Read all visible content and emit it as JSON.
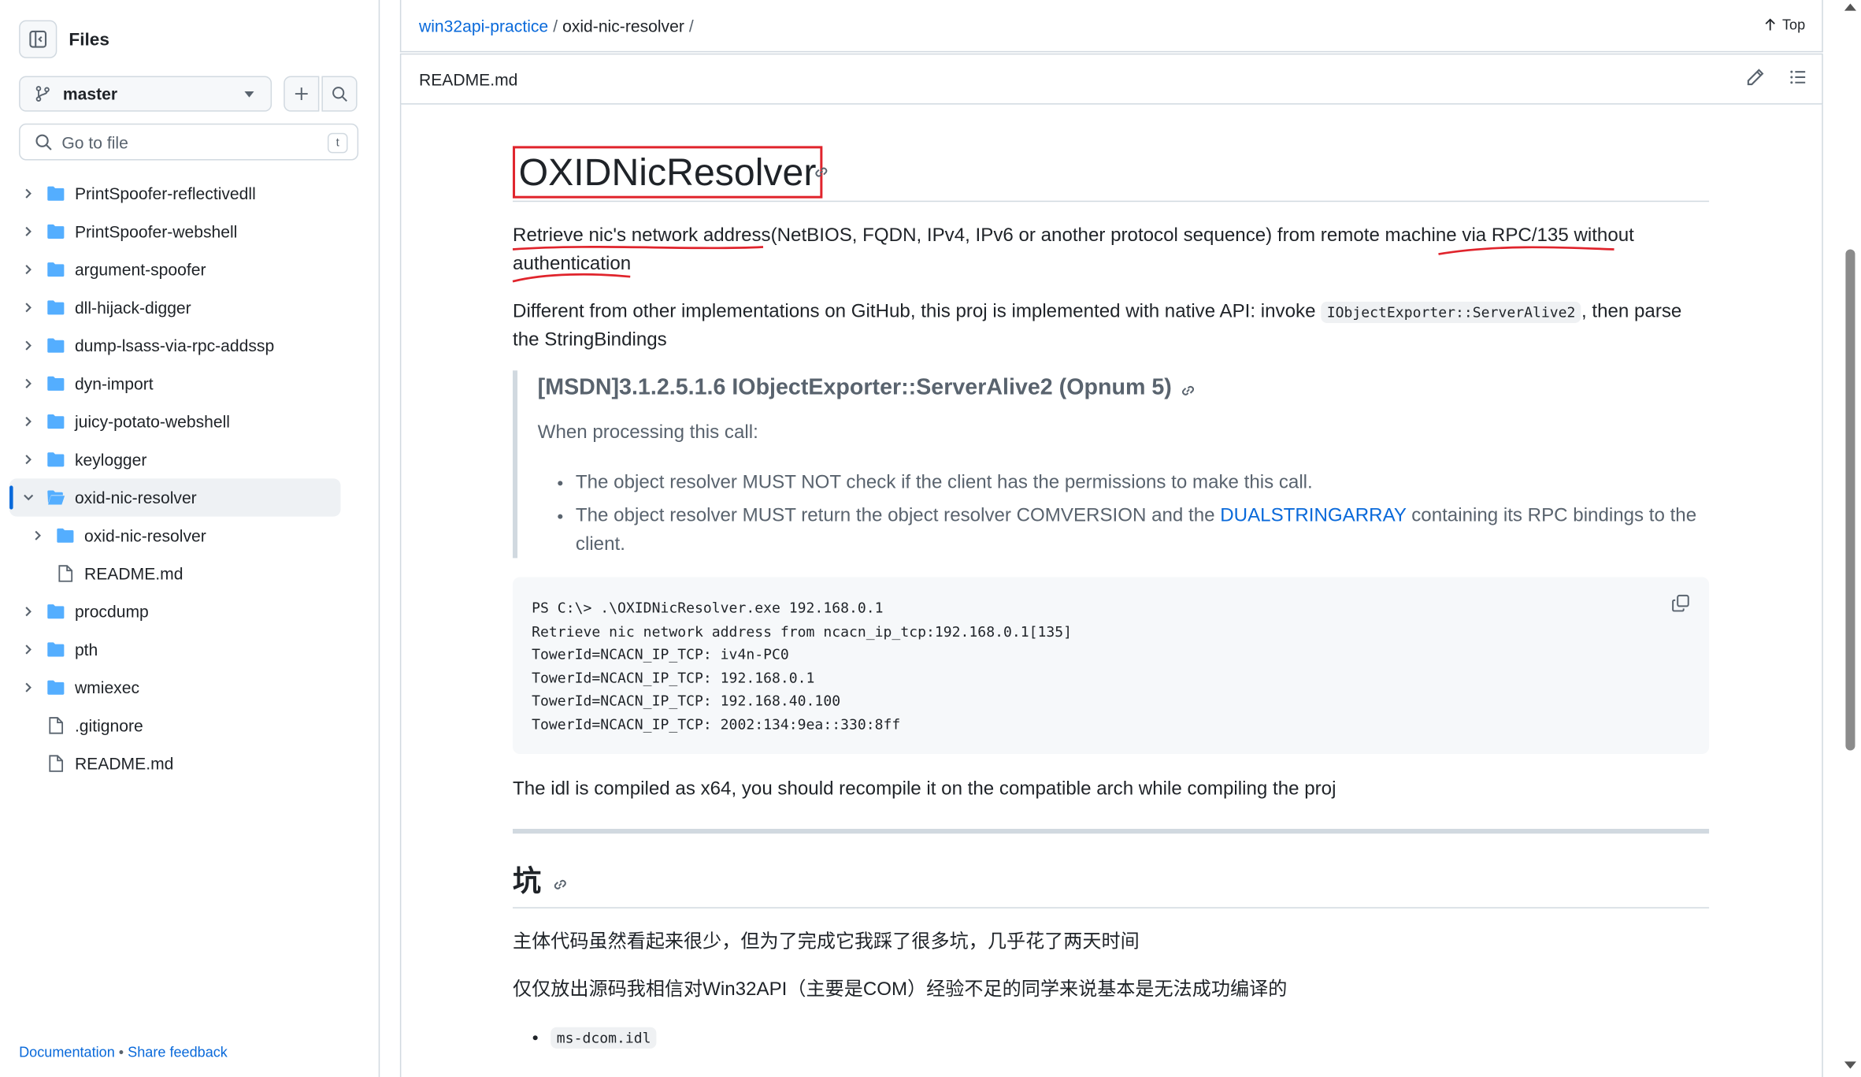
{
  "sidebar": {
    "title": "Files",
    "branch": "master",
    "goto_placeholder": "Go to file",
    "goto_shortcut": "t",
    "tree": [
      {
        "label": "PrintSpoofer-reflectivedll",
        "type": "folder",
        "level": 0,
        "expanded": false
      },
      {
        "label": "PrintSpoofer-webshell",
        "type": "folder",
        "level": 0,
        "expanded": false
      },
      {
        "label": "argument-spoofer",
        "type": "folder",
        "level": 0,
        "expanded": false
      },
      {
        "label": "dll-hijack-digger",
        "type": "folder",
        "level": 0,
        "expanded": false
      },
      {
        "label": "dump-lsass-via-rpc-addssp",
        "type": "folder",
        "level": 0,
        "expanded": false
      },
      {
        "label": "dyn-import",
        "type": "folder",
        "level": 0,
        "expanded": false
      },
      {
        "label": "juicy-potato-webshell",
        "type": "folder",
        "level": 0,
        "expanded": false
      },
      {
        "label": "keylogger",
        "type": "folder",
        "level": 0,
        "expanded": false
      },
      {
        "label": "oxid-nic-resolver",
        "type": "folder",
        "level": 0,
        "expanded": true,
        "active": true
      },
      {
        "label": "oxid-nic-resolver",
        "type": "folder",
        "level": 1,
        "expanded": false
      },
      {
        "label": "README.md",
        "type": "file",
        "level": 1
      },
      {
        "label": "procdump",
        "type": "folder",
        "level": 0,
        "expanded": false
      },
      {
        "label": "pth",
        "type": "folder",
        "level": 0,
        "expanded": false
      },
      {
        "label": "wmiexec",
        "type": "folder",
        "level": 0,
        "expanded": false
      },
      {
        "label": ".gitignore",
        "type": "file",
        "level": 0
      },
      {
        "label": "README.md",
        "type": "file",
        "level": 0
      }
    ],
    "footer": {
      "documentation": "Documentation",
      "separator": "•",
      "feedback": "Share feedback"
    }
  },
  "breadcrumb": {
    "repo": "win32api-practice",
    "sep1": "/",
    "folder": "oxid-nic-resolver",
    "sep2": "/",
    "top_label": "Top"
  },
  "file_header": {
    "filename": "README.md"
  },
  "readme": {
    "h1": "OXIDNicResolver",
    "p1": "Retrieve nic's network address(NetBIOS, FQDN, IPv4, IPv6 or another protocol sequence) from remote machine via RPC/135 without authentication",
    "p2_before": "Different from other implementations on GitHub, this proj is implemented with native API: invoke ",
    "p2_code": "IObjectExporter::ServerAlive2",
    "p2_after": ", then parse the StringBindings",
    "quote": {
      "heading": "[MSDN]3.1.2.5.1.6 IObjectExporter::ServerAlive2 (Opnum 5)",
      "intro": "When processing this call:",
      "item1": "The object resolver MUST NOT check if the client has the permissions to make this call.",
      "item2_before": "The object resolver MUST return the object resolver COMVERSION and the ",
      "item2_link": "DUALSTRINGARRAY",
      "item2_after": " containing its RPC bindings to the client."
    },
    "code_block": "PS C:\\> .\\OXIDNicResolver.exe 192.168.0.1\nRetrieve nic network address from ncacn_ip_tcp:192.168.0.1[135]\nTowerId=NCACN_IP_TCP: iv4n-PC0\nTowerId=NCACN_IP_TCP: 192.168.0.1\nTowerId=NCACN_IP_TCP: 192.168.40.100\nTowerId=NCACN_IP_TCP: 2002:134:9ea::330:8ff",
    "p3": "The idl is compiled as x64, you should recompile it on the compatible arch while compiling the proj",
    "h2": "坑",
    "p4": "主体代码虽然看起来很少，但为了完成它我踩了很多坑，几乎花了两天时间",
    "p5": "仅仅放出源码我相信对Win32API（主要是COM）经验不足的同学来说基本是无法成功编译的",
    "list_item1_code": "ms-dcom.idl"
  },
  "colors": {
    "accent": "#0969da",
    "annotation": "#e0242c",
    "border": "#d1d9e0"
  }
}
